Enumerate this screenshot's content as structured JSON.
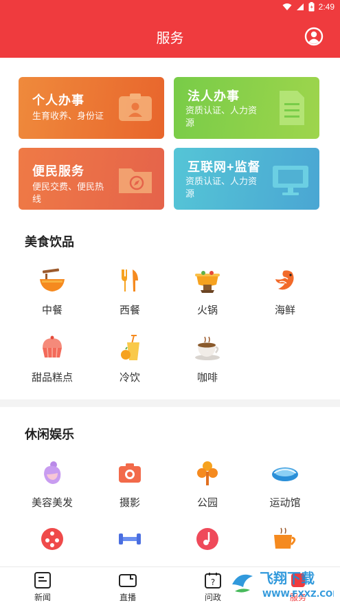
{
  "status_bar": {
    "time": "2:49",
    "icons": [
      "wifi-icon",
      "signal-icon",
      "battery-icon"
    ]
  },
  "header": {
    "title": "服务",
    "profile_icon": "person-circle-icon"
  },
  "colors": {
    "primary": "#ef3b3e"
  },
  "service_cards": [
    {
      "title": "个人办事",
      "subtitle": "生育收养、身份证",
      "icon": "id-card-icon"
    },
    {
      "title": "法人办事",
      "subtitle": "资质认证、人力资源",
      "icon": "document-icon"
    },
    {
      "title": "便民服务",
      "subtitle": "便民交费、便民热线",
      "icon": "folder-compass-icon"
    },
    {
      "title": "互联网+监督",
      "subtitle": "资质认证、人力资源",
      "icon": "monitor-icon"
    }
  ],
  "food_section": {
    "heading": "美食饮品",
    "items": [
      {
        "label": "中餐",
        "icon": "noodle-bowl-icon"
      },
      {
        "label": "西餐",
        "icon": "fork-knife-icon"
      },
      {
        "label": "火锅",
        "icon": "hotpot-icon"
      },
      {
        "label": "海鲜",
        "icon": "shrimp-icon"
      },
      {
        "label": "甜品糕点",
        "icon": "cupcake-icon"
      },
      {
        "label": "冷饮",
        "icon": "cold-drink-icon"
      },
      {
        "label": "咖啡",
        "icon": "coffee-cup-icon"
      }
    ]
  },
  "leisure_section": {
    "heading": "休闲娱乐",
    "items": [
      {
        "label": "美容美发",
        "icon": "beauty-face-icon"
      },
      {
        "label": "摄影",
        "icon": "camera-icon"
      },
      {
        "label": "公园",
        "icon": "tree-icon"
      },
      {
        "label": "运动馆",
        "icon": "stadium-icon"
      },
      {
        "label": "",
        "icon": "film-reel-icon"
      },
      {
        "label": "",
        "icon": "dumbbell-icon"
      },
      {
        "label": "",
        "icon": "music-note-icon"
      },
      {
        "label": "",
        "icon": "tea-cup-icon"
      }
    ]
  },
  "tab_bar": {
    "tabs": [
      {
        "label": "新闻",
        "icon": "news-icon"
      },
      {
        "label": "直播",
        "icon": "video-camera-icon"
      },
      {
        "label": "问政",
        "icon": "question-calendar-icon"
      },
      {
        "label": "服务",
        "icon": "service-icon",
        "active": true
      }
    ]
  },
  "watermark": {
    "text": "飞翔下载",
    "url": "WWW.FXXZ.COM"
  }
}
